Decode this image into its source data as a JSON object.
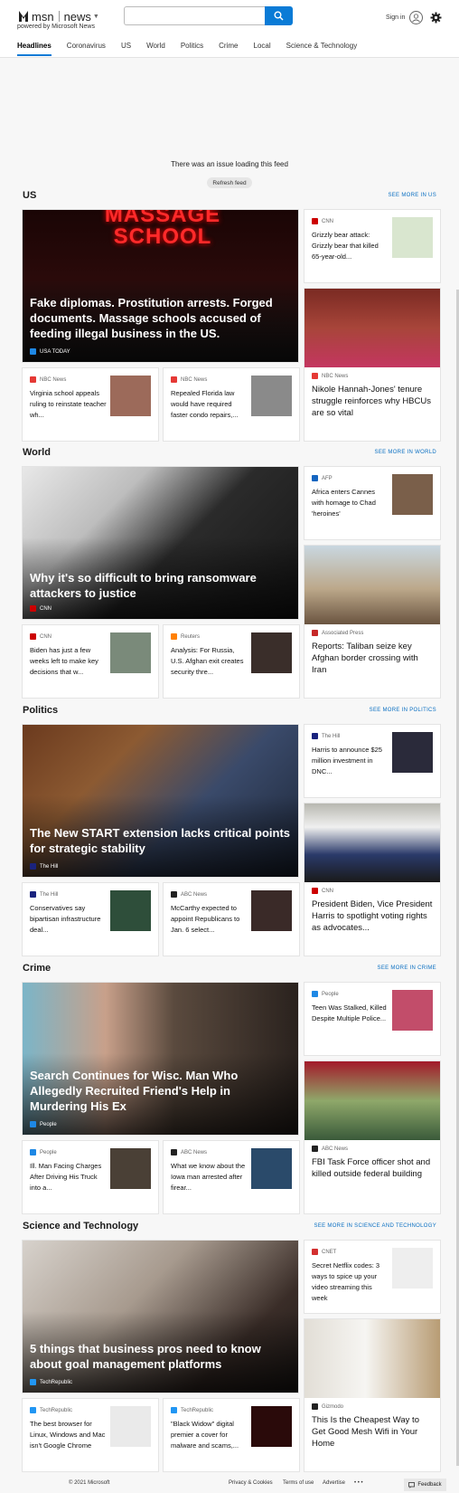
{
  "header": {
    "brand": "msn",
    "section": "news",
    "powered_by": "powered by Microsoft News",
    "search_placeholder": "",
    "sign_in": "Sign in"
  },
  "nav": [
    "Headlines",
    "Coronavirus",
    "US",
    "World",
    "Politics",
    "Crime",
    "Local",
    "Science & Technology"
  ],
  "feed_error": {
    "message": "There was an issue loading this feed",
    "button": "Refresh feed"
  },
  "sections": [
    {
      "title": "US",
      "see_more": "SEE MORE IN US",
      "hero": {
        "title": "Fake diplomas. Prostitution arrests. Forged documents. Massage schools accused of feeding illegal business in the US.",
        "source": "USA TODAY",
        "overlay_text": "MASSAGE SCHOOL"
      },
      "minis": [
        {
          "source": "NBC News",
          "title": "Virginia school appeals ruling to reinstate teacher wh..."
        },
        {
          "source": "NBC News",
          "title": "Repealed Florida law would have required faster condo repairs,..."
        }
      ],
      "side_top": {
        "source": "CNN",
        "title": "Grizzly bear attack: Grizzly bear that killed 65-year-old..."
      },
      "side_bottom": {
        "source": "NBC News",
        "title": "Nikole Hannah-Jones' tenure struggle reinforces why HBCUs are so vital"
      }
    },
    {
      "title": "World",
      "see_more": "SEE MORE IN WORLD",
      "hero": {
        "title": "Why it's so difficult to bring ransomware attackers to justice",
        "source": "CNN"
      },
      "minis": [
        {
          "source": "CNN",
          "title": "Biden has just a few weeks left to make key decisions that w..."
        },
        {
          "source": "Reuters",
          "title": "Analysis: For Russia, U.S. Afghan exit creates security thre..."
        }
      ],
      "side_top": {
        "source": "AFP",
        "title": "Africa enters Cannes with homage to Chad 'heroines'"
      },
      "side_bottom": {
        "source": "Associated Press",
        "title": "Reports: Taliban seize key Afghan border crossing with Iran"
      }
    },
    {
      "title": "Politics",
      "see_more": "SEE MORE IN POLITICS",
      "hero": {
        "title": "The New START extension lacks critical points for strategic stability",
        "source": "The Hill"
      },
      "minis": [
        {
          "source": "The Hill",
          "title": "Conservatives say bipartisan infrastructure deal..."
        },
        {
          "source": "ABC News",
          "title": "McCarthy expected to appoint Republicans to Jan. 6 select..."
        }
      ],
      "side_top": {
        "source": "The Hill",
        "title": "Harris to announce $25 million investment in DNC..."
      },
      "side_bottom": {
        "source": "CNN",
        "title": "President Biden, Vice President Harris to spotlight voting rights as advocates..."
      }
    },
    {
      "title": "Crime",
      "see_more": "SEE MORE IN CRIME",
      "hero": {
        "title": "Search Continues for Wisc. Man Who Allegedly Recruited Friend's Help in Murdering His Ex",
        "source": "People"
      },
      "minis": [
        {
          "source": "People",
          "title": "Ill. Man Facing Charges After Driving His Truck into a..."
        },
        {
          "source": "ABC News",
          "title": "What we know about the Iowa man arrested after firear..."
        }
      ],
      "side_top": {
        "source": "People",
        "title": "Teen Was Stalked, Killed Despite Multiple Police..."
      },
      "side_bottom": {
        "source": "ABC News",
        "title": "FBI Task Force officer shot and killed outside federal building"
      }
    },
    {
      "title": "Science and Technology",
      "see_more": "SEE MORE IN SCIENCE AND TECHNOLOGY",
      "hero": {
        "title": "5 things that business pros need to know about goal management platforms",
        "source": "TechRepublic"
      },
      "minis": [
        {
          "source": "TechRepublic",
          "title": "The best browser for Linux, Windows and Mac isn't Google Chrome"
        },
        {
          "source": "TechRepublic",
          "title": "\"Black Widow\" digital premier a cover for malware and scams,..."
        }
      ],
      "side_top": {
        "source": "CNET",
        "title": "Secret Netflix codes: 3 ways to spice up your video streaming this week"
      },
      "side_bottom": {
        "source": "Gizmodo",
        "title": "This Is the Cheapest Way to Get Good Mesh Wifi in Your Home"
      }
    }
  ],
  "footer": {
    "copyright": "© 2021 Microsoft",
    "links": [
      "Privacy & Cookies",
      "Terms of use",
      "Advertise"
    ],
    "more": "• • •",
    "feedback": "Feedback"
  },
  "colors": {
    "accent": "#0a7bd6",
    "link": "#0a6fc2"
  }
}
